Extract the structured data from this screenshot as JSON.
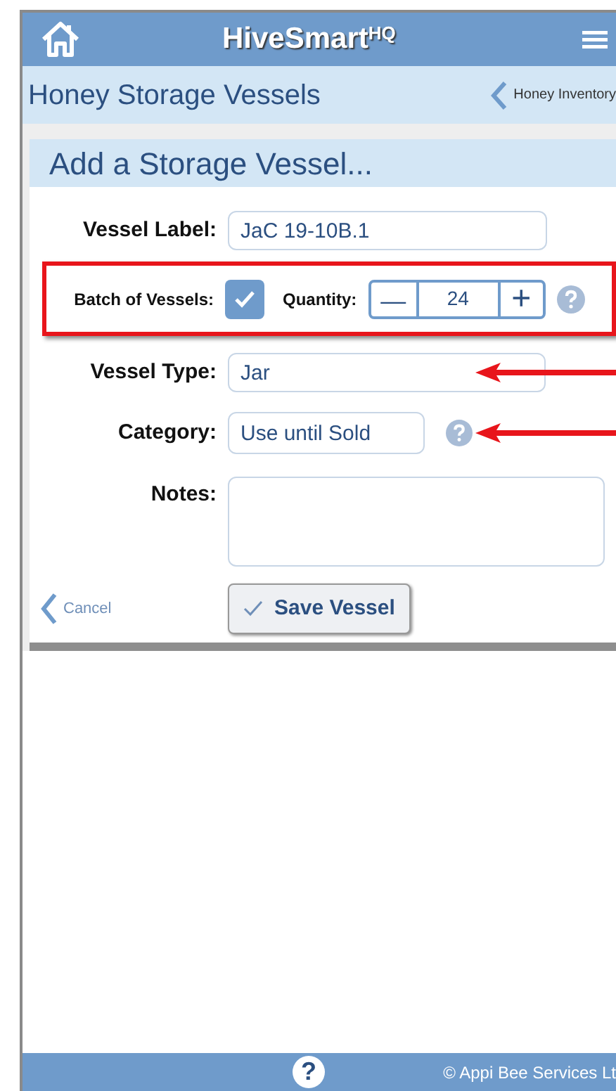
{
  "header": {
    "title": "HiveSmart",
    "title_sup": "HQ"
  },
  "subheader": {
    "title": "Honey Storage Vessels",
    "back_link": "Honey Inventory"
  },
  "card": {
    "title": "Add a Storage Vessel...",
    "vessel_label": {
      "label": "Vessel Label:",
      "value": "JaC 19-10B.1"
    },
    "batch": {
      "label": "Batch of Vessels:",
      "checked": true,
      "quantity_label": "Quantity:",
      "minus": "—",
      "plus": "+",
      "quantity": "24"
    },
    "vessel_type": {
      "label": "Vessel Type:",
      "value": "Jar"
    },
    "category": {
      "label": "Category:",
      "value": "Use until Sold"
    },
    "notes": {
      "label": "Notes:"
    },
    "cancel": "Cancel",
    "save": "Save Vessel"
  },
  "footer": {
    "help": "?",
    "copyright": "© Appi Bee Services Lt"
  }
}
